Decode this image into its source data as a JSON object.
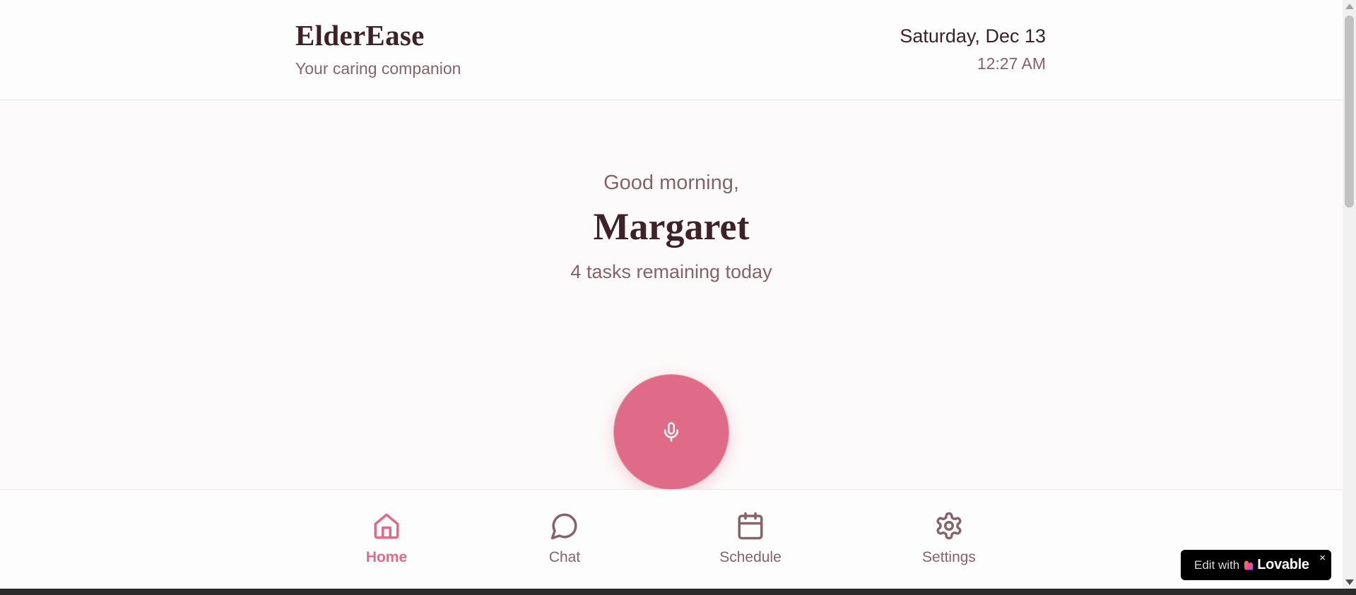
{
  "header": {
    "app_title": "ElderEase",
    "tagline": "Your caring companion",
    "date": "Saturday, Dec 13",
    "time": "12:27 AM"
  },
  "greeting": {
    "salutation": "Good morning,",
    "user_name": "Margaret",
    "tasks_status": "4 tasks remaining today"
  },
  "mic": {
    "icon": "microphone-icon"
  },
  "nav": {
    "items": [
      {
        "label": "Home",
        "icon": "home-icon",
        "active": true
      },
      {
        "label": "Chat",
        "icon": "chat-bubble-icon",
        "active": false
      },
      {
        "label": "Schedule",
        "icon": "calendar-icon",
        "active": false
      },
      {
        "label": "Settings",
        "icon": "gear-icon",
        "active": false
      }
    ]
  },
  "badge": {
    "edit_text": "Edit with",
    "brand": "Lovable",
    "close": "×"
  },
  "colors": {
    "accent": "#e06b89",
    "text_dark": "#3f2229",
    "text_muted": "#84636b",
    "background": "#fcfafa"
  }
}
